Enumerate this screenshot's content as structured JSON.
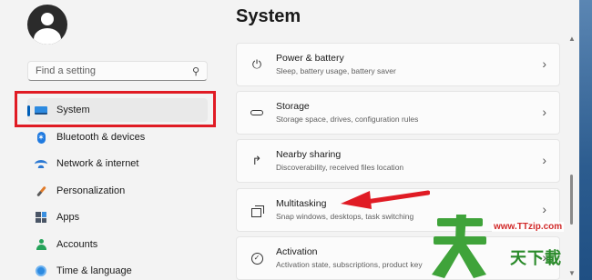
{
  "search": {
    "placeholder": "Find a setting"
  },
  "sidebar": {
    "items": [
      {
        "label": "System",
        "icon": "monitor-icon"
      },
      {
        "label": "Bluetooth & devices",
        "icon": "bluetooth-icon"
      },
      {
        "label": "Network & internet",
        "icon": "wifi-icon"
      },
      {
        "label": "Personalization",
        "icon": "brush-icon"
      },
      {
        "label": "Apps",
        "icon": "apps-icon"
      },
      {
        "label": "Accounts",
        "icon": "person-icon"
      },
      {
        "label": "Time & language",
        "icon": "globe-icon"
      }
    ]
  },
  "main": {
    "title": "System",
    "cards": [
      {
        "title": "Power & battery",
        "subtitle": "Sleep, battery usage, battery saver",
        "icon": "power-icon"
      },
      {
        "title": "Storage",
        "subtitle": "Storage space, drives, configuration rules",
        "icon": "storage-icon"
      },
      {
        "title": "Nearby sharing",
        "subtitle": "Discoverability, received files location",
        "icon": "share-icon"
      },
      {
        "title": "Multitasking",
        "subtitle": "Snap windows, desktops, task switching",
        "icon": "multitasking-icon"
      },
      {
        "title": "Activation",
        "subtitle": "Activation state, subscriptions, product key",
        "icon": "activation-icon"
      }
    ]
  },
  "watermark": {
    "url": "www.TTzip.com",
    "text": "天下載"
  },
  "colors": {
    "accent": "#005fb8",
    "annotation_red": "#e01b24"
  }
}
